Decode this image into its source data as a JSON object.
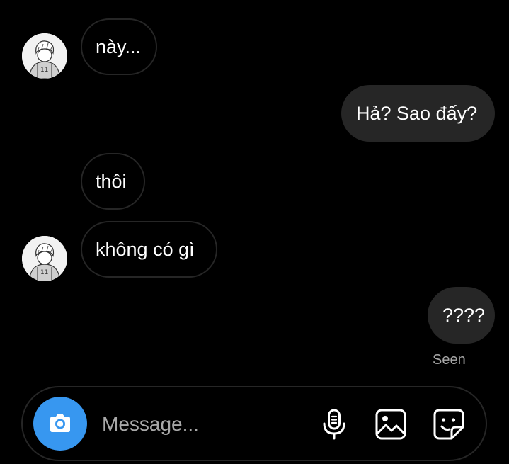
{
  "conversation": {
    "messages": [
      {
        "direction": "received",
        "text": "này...",
        "show_avatar": true
      },
      {
        "direction": "sent",
        "text": "Hả? Sao đấy?"
      },
      {
        "direction": "received",
        "text": "thôi",
        "show_avatar": false
      },
      {
        "direction": "received",
        "text": "không có gì",
        "show_avatar": true
      },
      {
        "direction": "sent",
        "text": "????"
      }
    ],
    "seen_label": "Seen"
  },
  "composer": {
    "placeholder": "Message...",
    "value": "",
    "camera_icon": "camera-icon",
    "tools": [
      "microphone-icon",
      "gallery-icon",
      "sticker-icon"
    ]
  },
  "colors": {
    "background": "#000000",
    "sent_bubble": "#262626",
    "received_border": "#262626",
    "camera_button": "#3797f0",
    "muted_text": "#a8a8a8"
  }
}
